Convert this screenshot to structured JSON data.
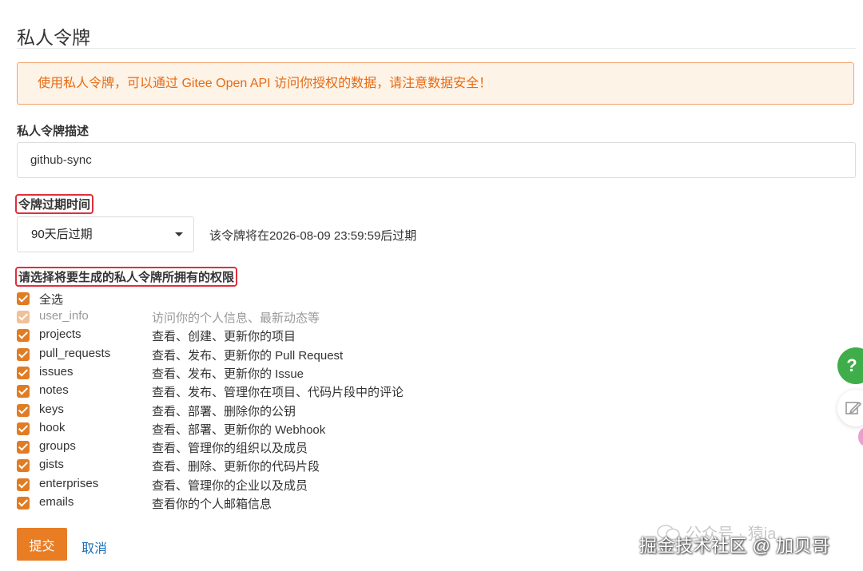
{
  "page": {
    "title": "私人令牌",
    "alert": "使用私人令牌，可以通过 Gitee Open API 访问你授权的数据，请注意数据安全！"
  },
  "form": {
    "description_label": "私人令牌描述",
    "description_value": "github-sync",
    "expiry_label": "令牌过期时间",
    "expiry_selected": "90天后过期",
    "expiry_note": "该令牌将在2026-08-09 23:59:59后过期",
    "permissions_label": "请选择将要生成的私人令牌所拥有的权限",
    "select_all_label": "全选",
    "submit_label": "提交",
    "cancel_label": "取消"
  },
  "permissions": [
    {
      "name": "user_info",
      "desc": "访问你的个人信息、最新动态等",
      "checked": true,
      "disabled": true
    },
    {
      "name": "projects",
      "desc": "查看、创建、更新你的项目",
      "checked": true,
      "disabled": false
    },
    {
      "name": "pull_requests",
      "desc": "查看、发布、更新你的 Pull Request",
      "checked": true,
      "disabled": false
    },
    {
      "name": "issues",
      "desc": "查看、发布、更新你的 Issue",
      "checked": true,
      "disabled": false
    },
    {
      "name": "notes",
      "desc": "查看、发布、管理你在项目、代码片段中的评论",
      "checked": true,
      "disabled": false
    },
    {
      "name": "keys",
      "desc": "查看、部署、删除你的公钥",
      "checked": true,
      "disabled": false
    },
    {
      "name": "hook",
      "desc": "查看、部署、更新你的 Webhook",
      "checked": true,
      "disabled": false
    },
    {
      "name": "groups",
      "desc": "查看、管理你的组织以及成员",
      "checked": true,
      "disabled": false
    },
    {
      "name": "gists",
      "desc": "查看、删除、更新你的代码片段",
      "checked": true,
      "disabled": false
    },
    {
      "name": "enterprises",
      "desc": "查看、管理你的企业以及成员",
      "checked": true,
      "disabled": false
    },
    {
      "name": "emails",
      "desc": "查看你的个人邮箱信息",
      "checked": true,
      "disabled": false
    }
  ],
  "floating": {
    "help_glyph": "?",
    "help_icon": "question-icon",
    "feedback_icon": "edit-icon"
  },
  "watermark": {
    "text": "公众号 · 猿ja",
    "credit": "掘金技术社区 @ 加贝哥"
  },
  "colors": {
    "accent": "#e97d24",
    "alert_text": "#e66b14",
    "alert_bg": "#fdf3e7",
    "highlight_box": "#e02f3b",
    "link": "#1a6fb8",
    "help_green": "#3fae4a"
  }
}
